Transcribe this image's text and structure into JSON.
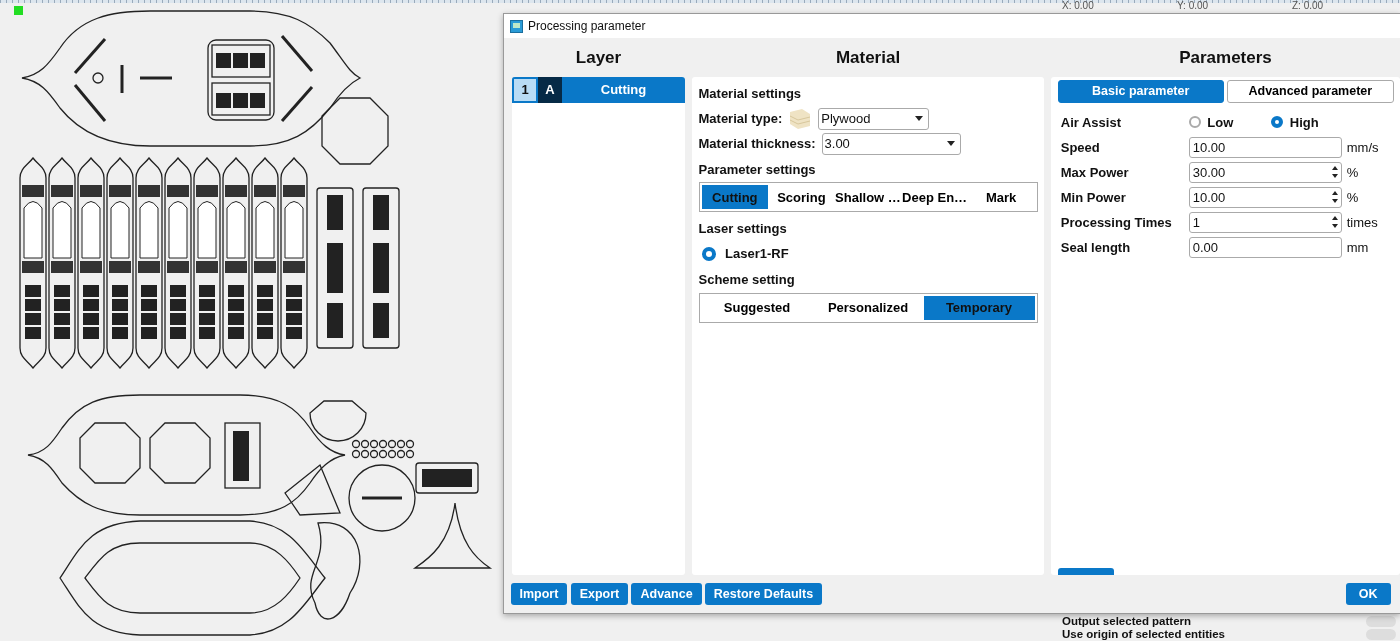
{
  "coordinates": [
    "X: 0.00",
    "Y: 0.00",
    "Z: 0.00"
  ],
  "dialog": {
    "title": "Processing parameter"
  },
  "layer": {
    "heading": "Layer",
    "items": [
      {
        "number": "1",
        "mode": "A",
        "name": "Cutting",
        "selected": true
      }
    ]
  },
  "material": {
    "heading": "Material",
    "material_settings": "Material settings",
    "material_type": {
      "label": "Material type:",
      "value": "Plywood"
    },
    "material_thickness": {
      "label": "Material thickness:",
      "value": "3.00"
    },
    "parameter_settings": "Parameter settings",
    "parameter_tabs": [
      {
        "label": "Cutting",
        "selected": true
      },
      {
        "label": "Scoring",
        "selected": false
      },
      {
        "label": "Shallow …",
        "selected": false
      },
      {
        "label": "Deep En…",
        "selected": false
      },
      {
        "label": "Mark",
        "selected": false
      }
    ],
    "laser_settings": "Laser settings",
    "lasers": [
      {
        "label": "Laser1-RF",
        "selected": true
      }
    ],
    "scheme_setting": "Scheme setting",
    "scheme_tabs": [
      {
        "label": "Suggested",
        "selected": false
      },
      {
        "label": "Personalized",
        "selected": false
      },
      {
        "label": "Temporary",
        "selected": true
      }
    ]
  },
  "parameters": {
    "heading": "Parameters",
    "tabs": [
      {
        "label": "Basic parameter",
        "selected": true
      },
      {
        "label": "Advanced parameter",
        "selected": false
      }
    ],
    "air_assist": {
      "label": "Air Assist",
      "options": [
        {
          "label": "Low",
          "selected": false
        },
        {
          "label": "High",
          "selected": true
        }
      ]
    },
    "fields": [
      {
        "label": "Speed",
        "value": "10.00",
        "unit": "mm/s",
        "kind": "plain"
      },
      {
        "label": "Max Power",
        "value": "30.00",
        "unit": "%",
        "kind": "spin"
      },
      {
        "label": "Min Power",
        "value": "10.00",
        "unit": "%",
        "kind": "spin"
      },
      {
        "label": "Processing Times",
        "value": "1",
        "unit": "times",
        "kind": "spin"
      },
      {
        "label": "Seal length",
        "value": "0.00",
        "unit": "mm",
        "kind": "plain"
      }
    ]
  },
  "buttons": [
    "Import",
    "Export",
    "Advance",
    "Restore Defaults"
  ],
  "ok_button": "OK",
  "background_options": [
    {
      "label": "Output selected pattern",
      "on": false
    },
    {
      "label": "Use origin of selected entities",
      "on": false
    }
  ]
}
